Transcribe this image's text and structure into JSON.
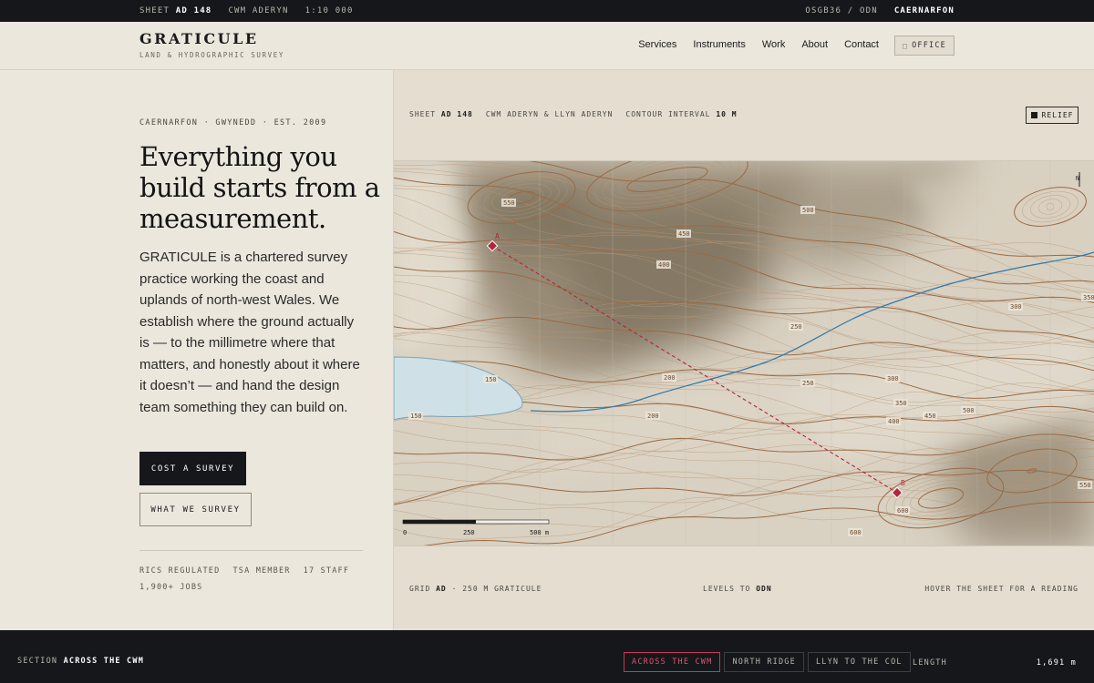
{
  "topbar": {
    "sheet_label": "SHEET",
    "sheet_id": "AD 148",
    "area": "CWM ADERYN",
    "scale": "1:10 000",
    "datum": "OSGB36 / ODN",
    "place": "CAERNARFON"
  },
  "brand": {
    "name": "GRATICULE",
    "tagline": "LAND & HYDROGRAPHIC SURVEY"
  },
  "nav": {
    "items": [
      "Services",
      "Instruments",
      "Work",
      "About",
      "Contact"
    ],
    "office_label": "OFFICE"
  },
  "hero": {
    "eyebrow": "CAERNARFON · GWYNEDD · EST. 2009",
    "title": "Everything you build starts from a measurement.",
    "lede": "GRATICULE is a chartered survey practice working the coast and uplands of north-west Wales. We establish where the ground actually is — to the millimetre where that matters, and honestly about it where it doesn’t — and hand the design team something they can build on.",
    "cta_primary": "COST A SURVEY",
    "cta_secondary": "WHAT WE SURVEY",
    "stats": [
      "RICS REGULATED",
      "TSA MEMBER",
      "17 STAFF",
      "1,900+ JOBS"
    ]
  },
  "map": {
    "caption_sheet_label": "SHEET",
    "caption_sheet_id": "AD 148",
    "caption_area": "CWM ADERYN & LLYN ADERYN",
    "caption_interval_label": "CONTOUR INTERVAL",
    "caption_interval": "10 M",
    "relief_label": "RELIEF",
    "north_label": "N",
    "contour_labels": [
      "550",
      "500",
      "450",
      "400",
      "250",
      "200",
      "150",
      "150",
      "200",
      "250",
      "300",
      "300",
      "350",
      "400",
      "450",
      "500",
      "350",
      "550",
      "600",
      "600"
    ],
    "point_a": "A",
    "point_b": "B",
    "scale_labels": [
      "0",
      "250",
      "500 m"
    ],
    "foot_grid_label": "GRID",
    "foot_grid_id": "AD",
    "foot_grid_text": "· 250 M GRATICULE",
    "foot_levels_label": "LEVELS TO",
    "foot_levels_val": "ODN",
    "foot_hint": "HOVER THE SHEET FOR A READING"
  },
  "section": {
    "label": "SECTION",
    "name": "ACROSS THE CWM",
    "tabs": [
      "ACROSS THE CWM",
      "NORTH RIDGE",
      "LLYN TO THE COL"
    ],
    "length_label": "LENGTH",
    "length_value": "1,691 m"
  },
  "colors": {
    "accent": "#b3243f",
    "water": "#2f79a8",
    "contour": "#9a6a45",
    "ink": "#15171a"
  }
}
